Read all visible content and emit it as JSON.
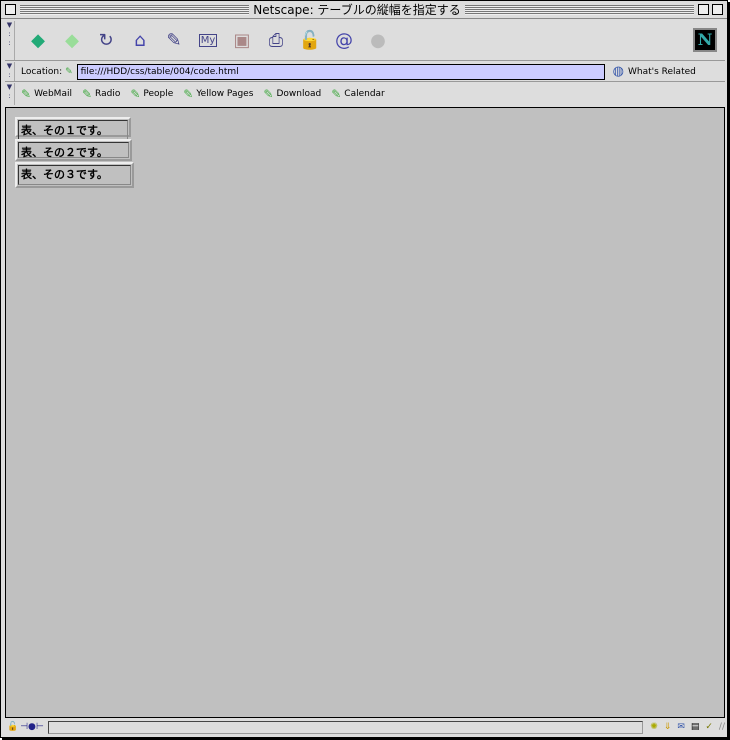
{
  "window": {
    "title": "Netscape: テーブルの縦幅を指定する"
  },
  "toolbar": {
    "buttons": [
      {
        "name": "back",
        "glyph": "◆",
        "color": "#2a7"
      },
      {
        "name": "forward",
        "glyph": "◆",
        "color": "#9d9"
      },
      {
        "name": "reload",
        "glyph": "↻",
        "color": "#448"
      },
      {
        "name": "home",
        "glyph": "⌂",
        "color": "#44a"
      },
      {
        "name": "search",
        "glyph": "✎",
        "color": "#448"
      },
      {
        "name": "my-netscape",
        "glyph": "My",
        "color": "#448"
      },
      {
        "name": "images",
        "glyph": "▣",
        "color": "#a88"
      },
      {
        "name": "print",
        "glyph": "⎙",
        "color": "#448"
      },
      {
        "name": "security",
        "glyph": "🔓",
        "color": "#c33"
      },
      {
        "name": "shop",
        "glyph": "@",
        "color": "#44a"
      },
      {
        "name": "stop",
        "glyph": "●",
        "color": "#bbb"
      }
    ],
    "logo": "N"
  },
  "location": {
    "label": "Location:",
    "url": "file:///HDD/css/table/004/code.html",
    "related": "What's Related"
  },
  "bookmarks": [
    "WebMail",
    "Radio",
    "People",
    "Yellow Pages",
    "Download",
    "Calendar"
  ],
  "tables": [
    "表、その１です。",
    "表、その２です。",
    "表、その３です。"
  ]
}
